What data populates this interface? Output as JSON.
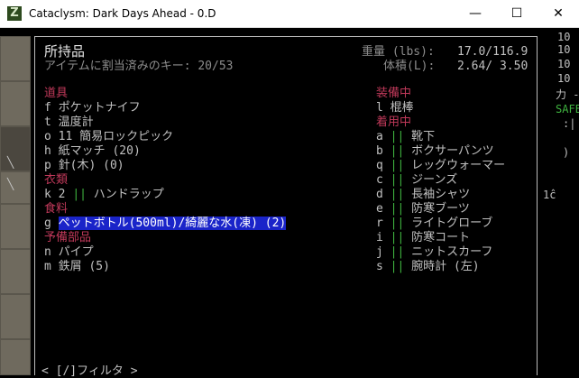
{
  "window": {
    "title": "Cataclysm: Dark Days Ahead - 0.D",
    "icon_glyph": "Z",
    "minimize": "—",
    "maximize": "☐",
    "close": "✕"
  },
  "header": {
    "title": "所持品",
    "subtitle": "アイテムに割当済みのキー: 20/53",
    "weight_label": "重量 (lbs):",
    "weight_value": "17.0/116.9",
    "volume_label": "体積(L):",
    "volume_value": "2.64/ 3.50"
  },
  "left": {
    "tools": {
      "category": "道具",
      "items": [
        {
          "key": "f",
          "name": "ポケットナイフ"
        },
        {
          "key": "t",
          "name": "温度計"
        },
        {
          "key": "o",
          "name": "11 簡易ロックピック"
        },
        {
          "key": "h",
          "name": "紙マッチ (20)"
        },
        {
          "key": "p",
          "name": "針(木) (0)"
        }
      ]
    },
    "clothing": {
      "category": "衣類",
      "items": [
        {
          "key": "k",
          "count": "2",
          "bars": "||",
          "name": "ハンドラップ"
        }
      ]
    },
    "food": {
      "category": "食料",
      "items": [
        {
          "key": "g",
          "name": "ペットボトル(500ml)/綺麗な水(凍) (2)"
        }
      ]
    },
    "spare": {
      "category": "予備部品",
      "items": [
        {
          "key": "n",
          "name": "パイプ"
        },
        {
          "key": "m",
          "name": "鉄屑 (5)"
        }
      ]
    }
  },
  "right": {
    "wielded": {
      "category": "装備中",
      "items": [
        {
          "key": "l",
          "name": "棍棒"
        }
      ]
    },
    "worn": {
      "category": "着用中",
      "items": [
        {
          "key": "a",
          "name": "靴下"
        },
        {
          "key": "b",
          "name": "ボクサーパンツ"
        },
        {
          "key": "q",
          "name": "レッグウォーマー"
        },
        {
          "key": "c",
          "name": "ジーンズ"
        },
        {
          "key": "d",
          "name": "長袖シャツ"
        },
        {
          "key": "e",
          "name": "防寒ブーツ"
        },
        {
          "key": "r",
          "name": "ライトグローブ"
        },
        {
          "key": "i",
          "name": "防寒コート"
        },
        {
          "key": "j",
          "name": "ニットスカーフ"
        },
        {
          "key": "s",
          "name": "腕時計 (左)"
        }
      ]
    }
  },
  "side": {
    "l1": "10",
    "l2": "10",
    "l3": "10",
    "l4": "10",
    "l5": "力 --",
    "safe": "SAFE",
    "l7": ":|",
    "l8": ")",
    "l9": "1ĉ"
  },
  "footer": {
    "filter": "< [/]フィルタ >"
  }
}
